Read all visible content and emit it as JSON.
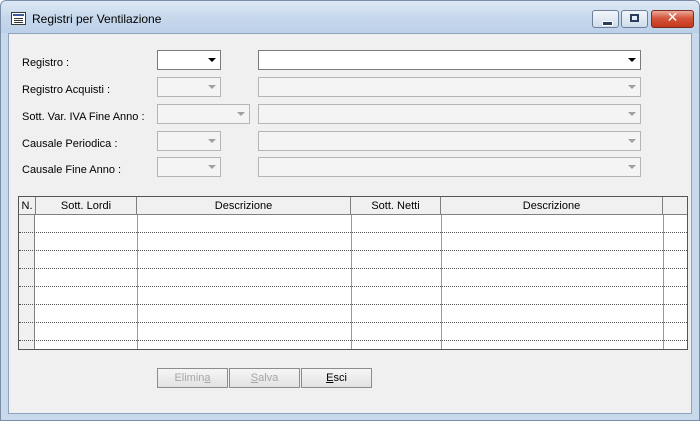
{
  "window": {
    "title": "Registri per Ventilazione",
    "controls": {
      "minimize": "minimize",
      "maximize": "maximize",
      "close": "✕"
    }
  },
  "form": {
    "fields": [
      {
        "label": "Registro :",
        "code_value": "",
        "desc_value": "",
        "enabled": true
      },
      {
        "label": "Registro Acquisti :",
        "code_value": "",
        "desc_value": "",
        "enabled": false
      },
      {
        "label": "Sott. Var. IVA Fine Anno :",
        "code_value": "",
        "desc_value": "",
        "enabled": false
      },
      {
        "label": "Causale Periodica :",
        "code_value": "",
        "desc_value": "",
        "enabled": false
      },
      {
        "label": "Causale  Fine Anno :",
        "code_value": "",
        "desc_value": "",
        "enabled": false
      }
    ]
  },
  "grid": {
    "columns": [
      "N.",
      "Sott. Lordi",
      "Descrizione",
      "Sott. Netti",
      "Descrizione"
    ],
    "row_count": 7
  },
  "buttons": {
    "elimina": {
      "pre": "Elimin",
      "accel": "a",
      "post": "",
      "enabled": false
    },
    "salva": {
      "pre": "",
      "accel": "S",
      "post": "alva",
      "enabled": false
    },
    "esci": {
      "pre": "",
      "accel": "E",
      "post": "sci",
      "enabled": true
    }
  },
  "colors": {
    "titlebar": "#c7d8ec",
    "client_bg": "#f0f0f0",
    "close_button": "#c4371c",
    "disabled_text": "#a6a6a6"
  }
}
